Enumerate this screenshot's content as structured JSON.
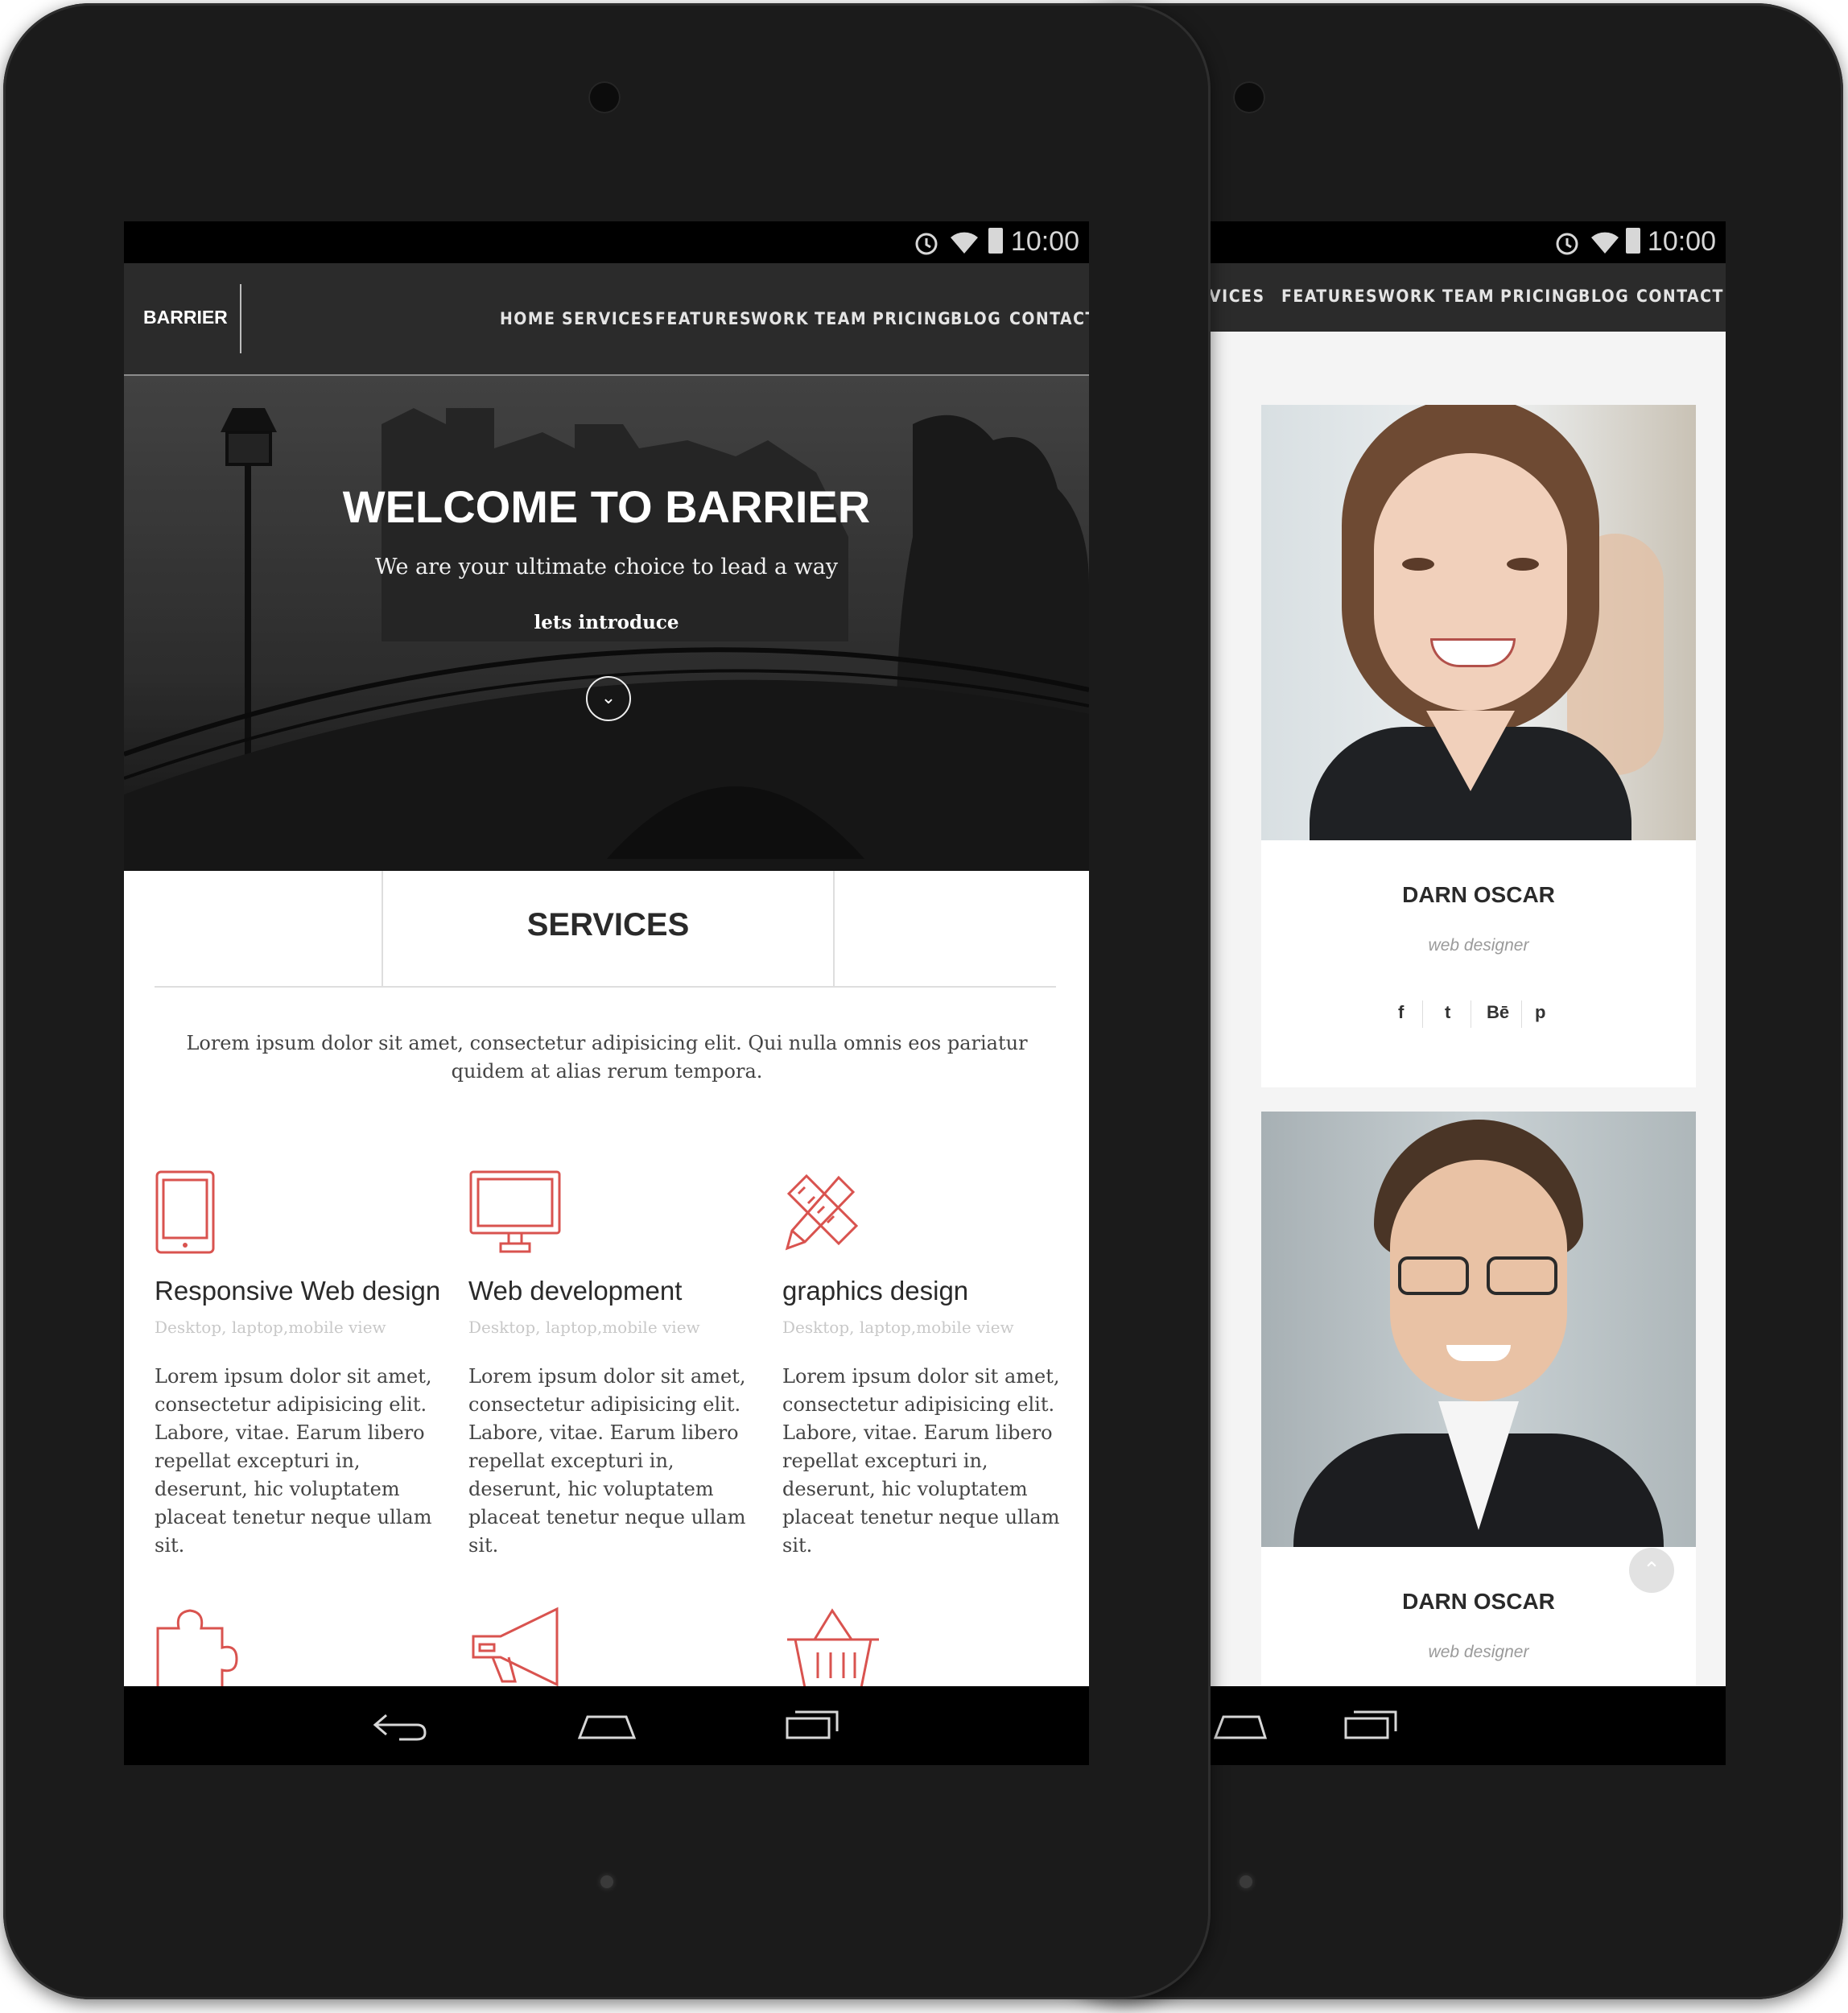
{
  "status_bar": {
    "time": "10:00"
  },
  "front": {
    "brand": "BARRIER",
    "nav": [
      "HOME",
      "SERVICES",
      "FEATURES",
      "WORK",
      "TEAM",
      "PRICING",
      "BLOG",
      "CONTACT"
    ],
    "hero": {
      "title": "WELCOME TO BARRIER",
      "subtitle": "We are your ultimate choice to lead a way",
      "cta": "lets introduce"
    },
    "services": {
      "heading": "SERVICES",
      "intro": "Lorem ipsum dolor sit amet, consectetur adipisicing elit. Qui nulla omnis eos pariatur quidem at alias rerum tempora.",
      "items": [
        {
          "title": "Responsive Web design",
          "sub": "Desktop, laptop,mobile view",
          "body": "Lorem ipsum dolor sit amet, consectetur adipisicing elit. Labore, vitae. Earum libero repellat excepturi in, deserunt, hic voluptatem placeat tenetur neque ullam sit.",
          "icon": "tablet-icon"
        },
        {
          "title": "Web development",
          "sub": "Desktop, laptop,mobile view",
          "body": "Lorem ipsum dolor sit amet, consectetur adipisicing elit. Labore, vitae. Earum libero repellat excepturi in, deserunt, hic voluptatem placeat tenetur neque ullam sit.",
          "icon": "monitor-icon"
        },
        {
          "title": "graphics design",
          "sub": "Desktop, laptop,mobile view",
          "body": "Lorem ipsum dolor sit amet, consectetur adipisicing elit. Labore, vitae. Earum libero repellat excepturi in, deserunt, hic voluptatem placeat tenetur neque ullam sit.",
          "icon": "pencil-ruler-icon"
        }
      ],
      "next_icons": [
        "puzzle-icon",
        "megaphone-icon",
        "basket-icon"
      ]
    }
  },
  "back": {
    "nav": [
      "RVICES",
      "FEATURES",
      "WORK",
      "TEAM",
      "PRICING",
      "BLOG",
      "CONTACT"
    ],
    "team": [
      {
        "name": "DARN OSCAR",
        "role": "web designer",
        "socials": [
          "f",
          "t",
          "Bē",
          "p"
        ]
      },
      {
        "name": "DARN OSCAR",
        "role": "web designer"
      }
    ]
  },
  "colors": {
    "accent": "#d9534f",
    "nav_bg": "#2b2b2b",
    "device": "#1b1b1b"
  }
}
